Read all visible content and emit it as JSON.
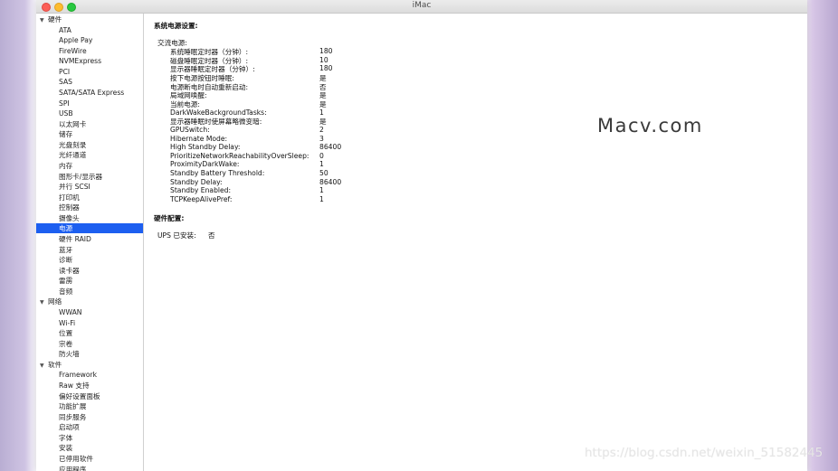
{
  "window": {
    "title": "iMac"
  },
  "sidebar": {
    "rows": [
      {
        "label": "硬件",
        "kind": "cat"
      },
      {
        "label": "ATA",
        "kind": "item"
      },
      {
        "label": "Apple Pay",
        "kind": "item"
      },
      {
        "label": "FireWire",
        "kind": "item"
      },
      {
        "label": "NVMExpress",
        "kind": "item"
      },
      {
        "label": "PCI",
        "kind": "item"
      },
      {
        "label": "SAS",
        "kind": "item"
      },
      {
        "label": "SATA/SATA Express",
        "kind": "item"
      },
      {
        "label": "SPI",
        "kind": "item"
      },
      {
        "label": "USB",
        "kind": "item"
      },
      {
        "label": "以太网卡",
        "kind": "item"
      },
      {
        "label": "储存",
        "kind": "item"
      },
      {
        "label": "光盘刻录",
        "kind": "item"
      },
      {
        "label": "光纤通道",
        "kind": "item"
      },
      {
        "label": "内存",
        "kind": "item"
      },
      {
        "label": "图形卡/显示器",
        "kind": "item"
      },
      {
        "label": "并行 SCSI",
        "kind": "item"
      },
      {
        "label": "打印机",
        "kind": "item"
      },
      {
        "label": "控制器",
        "kind": "item"
      },
      {
        "label": "摄像头",
        "kind": "item"
      },
      {
        "label": "电源",
        "kind": "item",
        "selected": true
      },
      {
        "label": "硬件 RAID",
        "kind": "item"
      },
      {
        "label": "蓝牙",
        "kind": "item"
      },
      {
        "label": "诊断",
        "kind": "item"
      },
      {
        "label": "读卡器",
        "kind": "item"
      },
      {
        "label": "雷雳",
        "kind": "item"
      },
      {
        "label": "音频",
        "kind": "item"
      },
      {
        "label": "网络",
        "kind": "cat"
      },
      {
        "label": "WWAN",
        "kind": "item"
      },
      {
        "label": "Wi-Fi",
        "kind": "item"
      },
      {
        "label": "位置",
        "kind": "item"
      },
      {
        "label": "宗卷",
        "kind": "item"
      },
      {
        "label": "防火墙",
        "kind": "item"
      },
      {
        "label": "软件",
        "kind": "cat"
      },
      {
        "label": "Framework",
        "kind": "item"
      },
      {
        "label": "Raw 支持",
        "kind": "item"
      },
      {
        "label": "偏好设置面板",
        "kind": "item"
      },
      {
        "label": "功能扩展",
        "kind": "item"
      },
      {
        "label": "同步服务",
        "kind": "item"
      },
      {
        "label": "启动项",
        "kind": "item"
      },
      {
        "label": "字体",
        "kind": "item"
      },
      {
        "label": "安装",
        "kind": "item"
      },
      {
        "label": "已停用软件",
        "kind": "item"
      },
      {
        "label": "应用程序",
        "kind": "item"
      }
    ]
  },
  "content": {
    "power_heading": "系统电源设置:",
    "ac_heading": "交流电源:",
    "settings": [
      {
        "key": "系统睡眠定时器（分钟）:",
        "value": "180"
      },
      {
        "key": "磁盘睡眠定时器（分钟）:",
        "value": "10"
      },
      {
        "key": "显示器睡眠定时器（分钟）:",
        "value": "180"
      },
      {
        "key": "按下电源按钮时睡眠:",
        "value": "是"
      },
      {
        "key": "电源断电时自动重新启动:",
        "value": "否"
      },
      {
        "key": "局域网唤醒:",
        "value": "是"
      },
      {
        "key": "当前电源:",
        "value": "是"
      },
      {
        "key": "DarkWakeBackgroundTasks:",
        "value": "1"
      },
      {
        "key": "显示器睡眠时使屏幕略微变暗:",
        "value": "是"
      },
      {
        "key": "GPUSwitch:",
        "value": "2"
      },
      {
        "key": "Hibernate Mode:",
        "value": "3"
      },
      {
        "key": "High Standby Delay:",
        "value": "86400"
      },
      {
        "key": "PrioritizeNetworkReachabilityOverSleep:",
        "value": "0"
      },
      {
        "key": "ProximityDarkWake:",
        "value": "1"
      },
      {
        "key": "Standby Battery Threshold:",
        "value": "50"
      },
      {
        "key": "Standby Delay:",
        "value": "86400"
      },
      {
        "key": "Standby Enabled:",
        "value": "1"
      },
      {
        "key": "TCPKeepAlivePref:",
        "value": "1"
      }
    ],
    "hardware_heading": "硬件配置:",
    "ups_label": "UPS 已安装:",
    "ups_value": "否"
  },
  "watermark": "Macv.com",
  "source_url": "https://blog.csdn.net/weixin_51582445"
}
